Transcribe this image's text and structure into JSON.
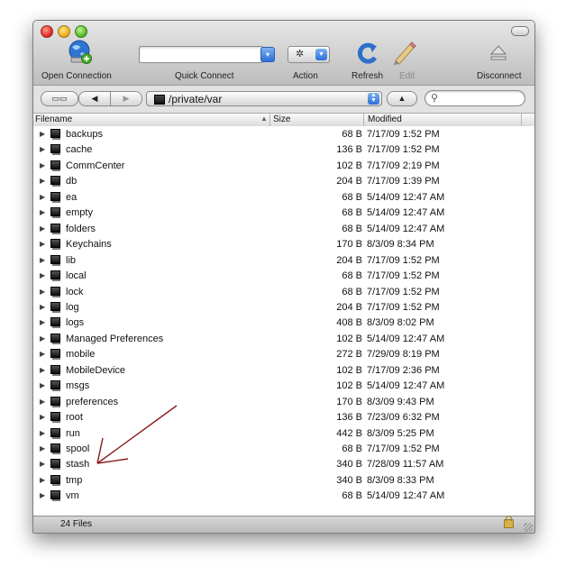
{
  "toolbar": {
    "open_connection": "Open Connection",
    "quick_connect": "Quick Connect",
    "quick_connect_value": "",
    "action": "Action",
    "refresh": "Refresh",
    "edit": "Edit",
    "disconnect": "Disconnect"
  },
  "pathbar": {
    "path": "/private/var",
    "search_value": ""
  },
  "columns": {
    "filename": "Filename",
    "size": "Size",
    "modified": "Modified"
  },
  "files": [
    {
      "name": "backups",
      "size": "68 B",
      "modified": "7/17/09 1:52 PM"
    },
    {
      "name": "cache",
      "size": "136 B",
      "modified": "7/17/09 1:52 PM"
    },
    {
      "name": "CommCenter",
      "size": "102 B",
      "modified": "7/17/09 2:19 PM"
    },
    {
      "name": "db",
      "size": "204 B",
      "modified": "7/17/09 1:39 PM"
    },
    {
      "name": "ea",
      "size": "68 B",
      "modified": "5/14/09 12:47 AM"
    },
    {
      "name": "empty",
      "size": "68 B",
      "modified": "5/14/09 12:47 AM"
    },
    {
      "name": "folders",
      "size": "68 B",
      "modified": "5/14/09 12:47 AM"
    },
    {
      "name": "Keychains",
      "size": "170 B",
      "modified": "8/3/09 8:34 PM"
    },
    {
      "name": "lib",
      "size": "204 B",
      "modified": "7/17/09 1:52 PM"
    },
    {
      "name": "local",
      "size": "68 B",
      "modified": "7/17/09 1:52 PM"
    },
    {
      "name": "lock",
      "size": "68 B",
      "modified": "7/17/09 1:52 PM"
    },
    {
      "name": "log",
      "size": "204 B",
      "modified": "7/17/09 1:52 PM"
    },
    {
      "name": "logs",
      "size": "408 B",
      "modified": "8/3/09 8:02 PM"
    },
    {
      "name": "Managed Preferences",
      "size": "102 B",
      "modified": "5/14/09 12:47 AM"
    },
    {
      "name": "mobile",
      "size": "272 B",
      "modified": "7/29/09 8:19 PM"
    },
    {
      "name": "MobileDevice",
      "size": "102 B",
      "modified": "7/17/09 2:36 PM"
    },
    {
      "name": "msgs",
      "size": "102 B",
      "modified": "5/14/09 12:47 AM"
    },
    {
      "name": "preferences",
      "size": "170 B",
      "modified": "8/3/09 9:43 PM"
    },
    {
      "name": "root",
      "size": "136 B",
      "modified": "7/23/09 6:32 PM"
    },
    {
      "name": "run",
      "size": "442 B",
      "modified": "8/3/09 5:25 PM"
    },
    {
      "name": "spool",
      "size": "68 B",
      "modified": "7/17/09 1:52 PM"
    },
    {
      "name": "stash",
      "size": "340 B",
      "modified": "7/28/09 11:57 AM"
    },
    {
      "name": "tmp",
      "size": "340 B",
      "modified": "8/3/09 8:33 PM"
    },
    {
      "name": "vm",
      "size": "68 B",
      "modified": "5/14/09 12:47 AM"
    }
  ],
  "status": {
    "file_count": "24 Files"
  },
  "annotation": {
    "arrow_color": "#8b1a1a",
    "arrow_target": "stash"
  },
  "colors": {
    "accent": "#2a6fd9",
    "folder_icon": "#111111",
    "window_bg": "#ececec"
  }
}
